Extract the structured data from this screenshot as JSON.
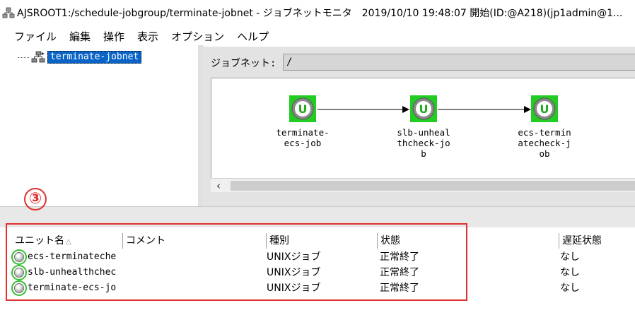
{
  "window": {
    "title": "AJSROOT1:/schedule-jobgroup/terminate-jobnet - ジョブネットモニタ　2019/10/10 19:48:07 開始(ID:@A218)(jp1admin@1..."
  },
  "menu": [
    "ファイル",
    "編集",
    "操作",
    "表示",
    "オプション",
    "ヘルプ"
  ],
  "tree": {
    "root_label": "terminate-jobnet"
  },
  "jobnet": {
    "label": "ジョブネット:",
    "value": "/"
  },
  "jobs": [
    {
      "name_lines": [
        "terminate-",
        "ecs-job"
      ],
      "status": "normal-end",
      "icon": "job-normal-icon"
    },
    {
      "name_lines": [
        "slb-unheal",
        "thcheck-jo",
        "b"
      ],
      "status": "normal-end",
      "icon": "job-normal-icon"
    },
    {
      "name_lines": [
        "ecs-termin",
        "atecheck-j",
        "ob"
      ],
      "status": "normal-end",
      "icon": "job-normal-icon"
    }
  ],
  "list": {
    "columns": [
      "ユニット名",
      "コメント",
      "種別",
      "状態",
      "遅延状態"
    ],
    "rows": [
      {
        "unit": "ecs-terminateche",
        "comment": "",
        "type": "UNIXジョブ",
        "state": "正常終了",
        "delay": "なし"
      },
      {
        "unit": "slb-unhealthchec",
        "comment": "",
        "type": "UNIXジョブ",
        "state": "正常終了",
        "delay": "なし"
      },
      {
        "unit": "terminate-ecs-jo",
        "comment": "",
        "type": "UNIXジョブ",
        "state": "正常終了",
        "delay": "なし"
      }
    ]
  },
  "annotation": {
    "number": "③",
    "color": "#e03030"
  },
  "colors": {
    "selection": "#0a64c8",
    "job_green": "#22cc22",
    "status_ring": "#30c030"
  }
}
